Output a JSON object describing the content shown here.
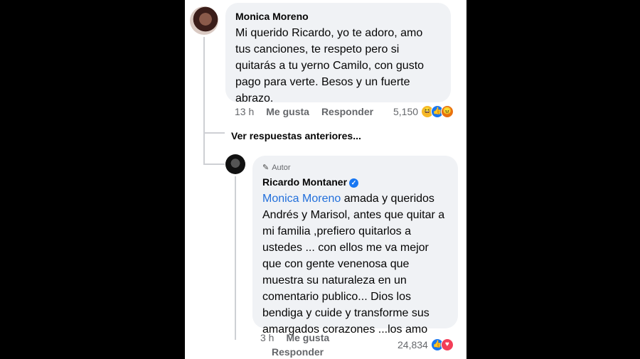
{
  "comment": {
    "author": "Monica Moreno",
    "text": "Mi querido Ricardo, yo te adoro, amo tus canciones, te respeto pero si quitarás a tu yerno Camilo, con gusto pago para verte. Besos y un fuerte abrazo.",
    "time": "13 h",
    "like_label": "Me gusta",
    "reply_label": "Responder",
    "reaction_count": "5,150",
    "reactions": [
      "haha-icon",
      "like-icon",
      "angry-icon"
    ]
  },
  "view_previous_label": "Ver respuestas anteriores...",
  "reply": {
    "badge": "Autor",
    "author": "Ricardo Montaner",
    "verified": true,
    "mention": "Monica Moreno",
    "text": " amada y queridos Andrés y Marisol, antes que quitar a mi familia ,prefiero quitarlos a ustedes ... con ellos me va mejor que con gente venenosa que muestra su naturaleza en un comentario publico... Dios los bendiga y cuide y transforme sus amargados corazones ...los amo",
    "time": "3 h",
    "like_label": "Me gusta",
    "reply_label": "Responder",
    "reaction_count": "24,834",
    "reactions": [
      "like-icon",
      "love-icon"
    ]
  },
  "colors": {
    "bubble": "#f0f2f5",
    "mention": "#216fdb",
    "secondary_text": "#65676b",
    "background": "#000000"
  }
}
